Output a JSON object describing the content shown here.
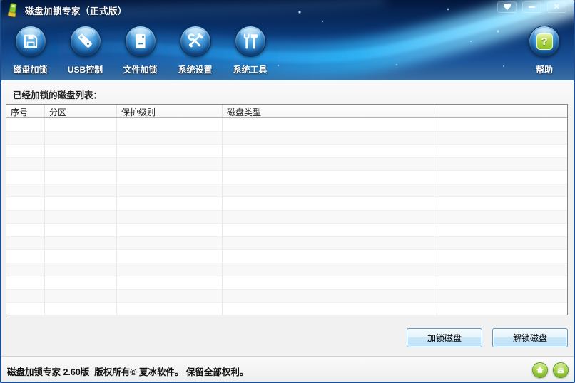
{
  "window": {
    "title": "磁盘加锁专家（正式版）",
    "controls": [
      {
        "name": "tray-button",
        "icon": "tray-arrow-icon"
      },
      {
        "name": "minimize-button",
        "icon": "minimize-icon"
      },
      {
        "name": "close-button",
        "icon": "close-icon",
        "glyph": "✕"
      }
    ]
  },
  "toolbar": {
    "items": [
      {
        "label": "磁盘加锁",
        "icon": "floppy-disk-icon"
      },
      {
        "label": "USB控制",
        "icon": "usb-drive-icon"
      },
      {
        "label": "文件加锁",
        "icon": "file-icon"
      },
      {
        "label": "系统设置",
        "icon": "settings-tools-icon"
      },
      {
        "label": "系统工具",
        "icon": "wrench-hammer-icon"
      }
    ],
    "help_label": "帮助",
    "help_icon": "question-icon",
    "help_glyph": "?"
  },
  "main": {
    "section_label": "已经加锁的磁盘列表："
  },
  "table": {
    "columns": [
      "序号",
      "分区",
      "保护级别",
      "磁盘类型"
    ],
    "rows": [],
    "empty_row_count": 15
  },
  "actions": {
    "lock": "加锁磁盘",
    "unlock": "解锁磁盘"
  },
  "statusbar": {
    "copyright": "磁盘加锁专家 2.60版  版权所有© 夏冰软件。 保留全部权利。",
    "icons": [
      "home-icon",
      "phone-icon"
    ]
  },
  "colors": {
    "banner_dark": "#03173c",
    "banner_swoosh": "#2eb4f6",
    "circle_blue": "#1a67ae",
    "help_green": "#8bbf27",
    "button_border": "#5e9bc8",
    "content_bg": "#f1f1f1"
  }
}
